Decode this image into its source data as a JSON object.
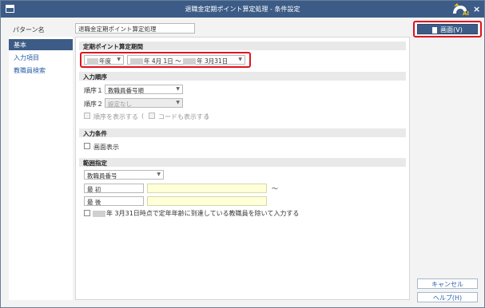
{
  "window": {
    "title": "退職金定期ポイント算定処理 - 条件設定",
    "close_label": "×"
  },
  "pattern": {
    "label": "パターン名",
    "value": "退職金定期ポイント算定処理"
  },
  "sidebar": {
    "items": [
      {
        "label": "基本",
        "active": true
      },
      {
        "label": "入力項目",
        "active": false
      },
      {
        "label": "教職員検索",
        "active": false
      }
    ]
  },
  "period": {
    "section_title": "定期ポイント算定期間",
    "year_suffix": "年度",
    "range_text": "年 4月 1日 〜",
    "range_end": "年 3月31日"
  },
  "order": {
    "section_title": "入力順序",
    "order1_label": "順序１",
    "order1_value": "教職員番号順",
    "order2_label": "順序２",
    "order2_value": "設定なし",
    "show_order_label": "順序を表示する",
    "paren_open": "(",
    "show_code_label": "コードも表示する",
    "paren_close": ")"
  },
  "conditions": {
    "section_title": "入力条件",
    "screen_display_label": "画面表示"
  },
  "range": {
    "section_title": "範囲指定",
    "key_value": "教職員番号",
    "first_label": "最 初",
    "last_label": "最 後",
    "tilde": "〜",
    "exclude_text": "年 3月31日時点で定年年齢に到達している教職員を除いて入力する"
  },
  "buttons": {
    "screen": "画面(V)",
    "cancel": "キャンセル",
    "help": "ヘルプ(H)"
  },
  "colors": {
    "title_bar": "#3c5c87",
    "highlight": "#e0141e",
    "input_yellow": "#ffffd8"
  }
}
